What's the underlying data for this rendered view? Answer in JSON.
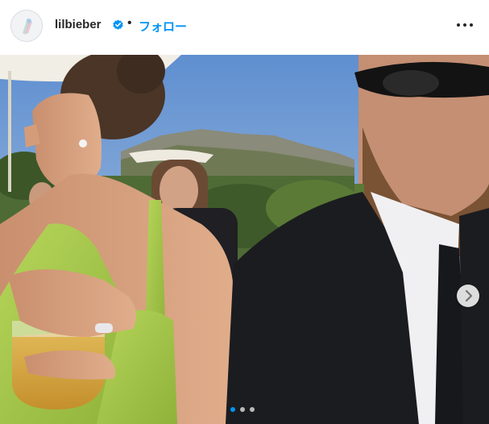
{
  "post_header": {
    "username": "lilbieber",
    "separator": "•",
    "follow_label": "フォロー",
    "verified_icon": "verified-badge-icon",
    "more_icon": "more-options-icon"
  },
  "carousel": {
    "current_index": 1,
    "total": 3,
    "next_icon": "chevron-right-icon"
  },
  "colors": {
    "follow_blue": "#0095f6",
    "verified_blue": "#0095f6",
    "text": "#262626",
    "dress_green": "#a6c94a"
  }
}
